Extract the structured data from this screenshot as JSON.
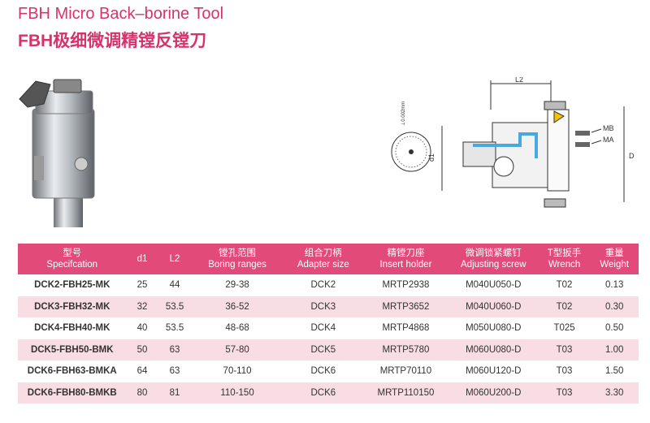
{
  "title": {
    "en": "FBH Micro Back–borine Tool",
    "cn": "FBH极细微调精镗反镗刀"
  },
  "diagram": {
    "scale_label": "⊥0.002mm",
    "l2_label": "L2",
    "d1_label": "d1",
    "d_label": "D",
    "mb_label": "MB",
    "ma_label": "MA"
  },
  "colors": {
    "accent": "#e24a7a",
    "title": "#d6336c",
    "stripe": "#f8dde4"
  },
  "table": {
    "headers": [
      {
        "cn": "型号",
        "en": "Specifcation"
      },
      {
        "cn": "",
        "en": "d1"
      },
      {
        "cn": "",
        "en": "L2"
      },
      {
        "cn": "镗孔范围",
        "en": "Boring ranges"
      },
      {
        "cn": "组合刀柄",
        "en": "Adapter size"
      },
      {
        "cn": "精镗刀座",
        "en": "Insert holder"
      },
      {
        "cn": "微调锁紧螺钉",
        "en": "Adjusting screw"
      },
      {
        "cn": "T型扳手",
        "en": "Wrench"
      },
      {
        "cn": "重量",
        "en": "Weight"
      }
    ],
    "rows": [
      [
        "DCK2-FBH25-MK",
        "25",
        "44",
        "29-38",
        "DCK2",
        "MRTP2938",
        "M040U050-D",
        "T02",
        "0.13"
      ],
      [
        "DCK3-FBH32-MK",
        "32",
        "53.5",
        "36-52",
        "DCK3",
        "MRTP3652",
        "M040U060-D",
        "T02",
        "0.30"
      ],
      [
        "DCK4-FBH40-MK",
        "40",
        "53.5",
        "48-68",
        "DCK4",
        "MRTP4868",
        "M050U080-D",
        "T025",
        "0.50"
      ],
      [
        "DCK5-FBH50-BMK",
        "50",
        "63",
        "57-80",
        "DCK5",
        "MRTP5780",
        "M060U080-D",
        "T03",
        "1.00"
      ],
      [
        "DCK6-FBH63-BMKA",
        "64",
        "63",
        "70-110",
        "DCK6",
        "MRTP70110",
        "M060U120-D",
        "T03",
        "1.50"
      ],
      [
        "DCK6-FBH80-BMKB",
        "80",
        "81",
        "110-150",
        "DCK6",
        "MRTP110150",
        "M060U200-D",
        "T03",
        "3.30"
      ]
    ]
  }
}
